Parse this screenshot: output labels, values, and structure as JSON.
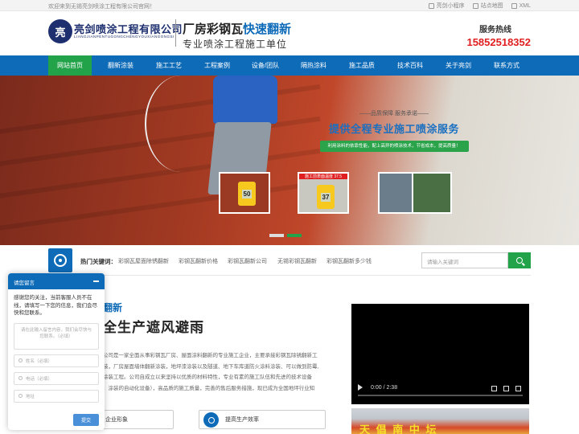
{
  "topbar": {
    "welcome": "欢迎来到无锡亮剑喷涂工程有限公司官网！",
    "mini_program": "亮剑小程序",
    "sitemap": "站点地图",
    "xml": "XML"
  },
  "header": {
    "logo_glyph": "亮",
    "company_name": "亮剑喷涂工程有限公司",
    "company_pinyin": "LIANGJIANPENTUGONGCHENGYOUXIANGONGSI",
    "slogan_main": "厂房彩钢瓦",
    "slogan_highlight": "快速翻新",
    "slogan_sub": "专业喷涂工程施工单位",
    "hotline_label": "服务热线",
    "hotline_number": "15852518352"
  },
  "nav": {
    "items": [
      {
        "label": "网站首页",
        "active": true
      },
      {
        "label": "翻新涂装",
        "active": false
      },
      {
        "label": "施工工艺",
        "active": false
      },
      {
        "label": "工程案例",
        "active": false
      },
      {
        "label": "设备/团队",
        "active": false
      },
      {
        "label": "隔热涂料",
        "active": false
      },
      {
        "label": "施工品质",
        "active": false
      },
      {
        "label": "技术百科",
        "active": false
      },
      {
        "label": "关于亮剑",
        "active": false
      },
      {
        "label": "联系方式",
        "active": false
      }
    ]
  },
  "banner": {
    "subtitle": "——品质保障 服务承诺——",
    "title": "提供全程专业施工喷涂服务",
    "strip": "利用涂料的依靠性能，配上高异的喷涂技术，节省成本，提高质量！",
    "gauge1": "50",
    "gauge2": "37",
    "thumb_tag": "施工前表面温度 37.5"
  },
  "keywords": {
    "label": "热门关键词：",
    "items": [
      "彩钢瓦屋面除锈翻新",
      "彩钢瓦翻新价格",
      "彩钢瓦翻新公司",
      "无锡彩钢瓦翻新",
      "彩钢瓦翻新多少钱"
    ],
    "search_placeholder": "请输入关键词"
  },
  "about": {
    "heading1": "翻新",
    "heading2": "全生产遮风避雨",
    "text_lines": [
      "公司是一家全面从事彩钢瓦厂房、屋面涂料翻新的专业施工企业，主要承接彩钢瓦除锈翻新工",
      "装，厂房屋面墙体翻新涂装，地坪漆涂装以及隧道、地下车库道防火涂料涂装、可以做到防霉,",
      "涂装工程。公司自成立以来坚持以优质的材料特性，专业有素的施工队伍和先进的技术设备",
      "，涂装的自动化设备），高品质的施工质量，完善的售后服务措施，现已成为全国地坪行业知"
    ],
    "feature1": "企业形象",
    "feature2": "提高生产效率"
  },
  "video": {
    "time": "0:00 / 2:38"
  },
  "photo": {
    "sign": "天 倡 南 中 坛"
  },
  "chat": {
    "title": "请您留言",
    "message": "感谢您的关注，当前客服人员不在线，请填写一下您的信息，我们会尽快和您联系。",
    "textarea_placeholder": "请在此输入留言内容，我们会尽快与您联系。（必填）",
    "phone_placeholder": "电话（必填）",
    "name_placeholder": "姓名（必填）",
    "address_placeholder": "地址",
    "submit": "提交"
  }
}
